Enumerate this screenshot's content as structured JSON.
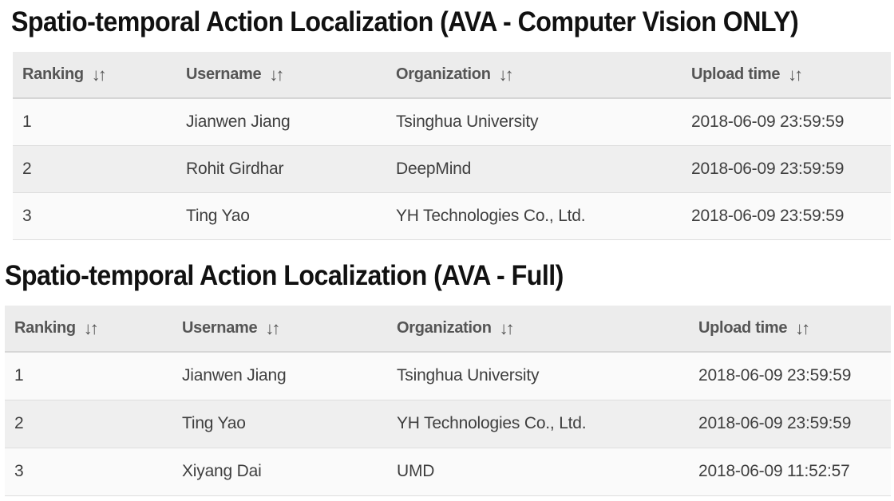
{
  "sections": [
    {
      "title": "Spatio-temporal Action Localization (AVA - Computer Vision ONLY)",
      "columns": [
        "Ranking",
        "Username",
        "Organization",
        "Upload time"
      ],
      "sort_icon": "sort-arrows-icon",
      "sort_glyph": "↓↑",
      "rows": [
        [
          "1",
          "Jianwen Jiang",
          "Tsinghua University",
          "2018-06-09 23:59:59"
        ],
        [
          "2",
          "Rohit Girdhar",
          "DeepMind",
          "2018-06-09 23:59:59"
        ],
        [
          "3",
          "Ting Yao",
          "YH Technologies Co., Ltd.",
          "2018-06-09 23:59:59"
        ]
      ]
    },
    {
      "title": "Spatio-temporal Action Localization (AVA - Full)",
      "columns": [
        "Ranking",
        "Username",
        "Organization",
        "Upload time"
      ],
      "sort_icon": "sort-arrows-icon",
      "sort_glyph": "↓↑",
      "rows": [
        [
          "1",
          "Jianwen Jiang",
          "Tsinghua University",
          "2018-06-09 23:59:59"
        ],
        [
          "2",
          "Ting Yao",
          "YH Technologies Co., Ltd.",
          "2018-06-09 23:59:59"
        ],
        [
          "3",
          "Xiyang Dai",
          "UMD",
          "2018-06-09 11:52:57"
        ]
      ]
    }
  ],
  "colors": {
    "header_bg": "#ececec",
    "row_odd_bg": "#fafafa",
    "row_even_bg": "#efefef",
    "title_text": "#111111",
    "cell_text": "#3f3f3f"
  }
}
